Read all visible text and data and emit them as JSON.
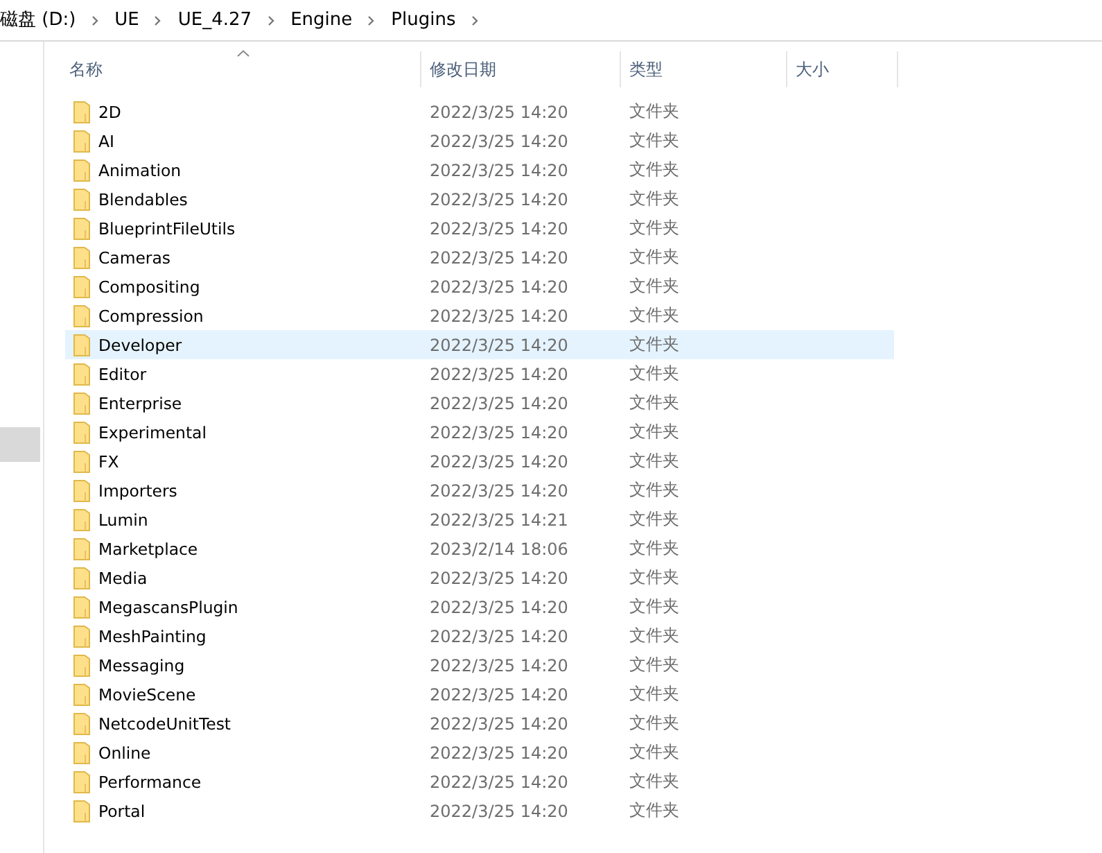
{
  "breadcrumb": [
    "磁盘 (D:)",
    "UE",
    "UE_4.27",
    "Engine",
    "Plugins"
  ],
  "columns": [
    {
      "label": "名称",
      "sorted": true
    },
    {
      "label": "修改日期",
      "sorted": false
    },
    {
      "label": "类型",
      "sorted": false
    },
    {
      "label": "大小",
      "sorted": false
    }
  ],
  "rows": [
    {
      "name": "2D",
      "modified": "2022/3/25 14:20",
      "type": "文件夹",
      "selected": false
    },
    {
      "name": "AI",
      "modified": "2022/3/25 14:20",
      "type": "文件夹",
      "selected": false
    },
    {
      "name": "Animation",
      "modified": "2022/3/25 14:20",
      "type": "文件夹",
      "selected": false
    },
    {
      "name": "Blendables",
      "modified": "2022/3/25 14:20",
      "type": "文件夹",
      "selected": false
    },
    {
      "name": "BlueprintFileUtils",
      "modified": "2022/3/25 14:20",
      "type": "文件夹",
      "selected": false
    },
    {
      "name": "Cameras",
      "modified": "2022/3/25 14:20",
      "type": "文件夹",
      "selected": false
    },
    {
      "name": "Compositing",
      "modified": "2022/3/25 14:20",
      "type": "文件夹",
      "selected": false
    },
    {
      "name": "Compression",
      "modified": "2022/3/25 14:20",
      "type": "文件夹",
      "selected": false
    },
    {
      "name": "Developer",
      "modified": "2022/3/25 14:20",
      "type": "文件夹",
      "selected": true
    },
    {
      "name": "Editor",
      "modified": "2022/3/25 14:20",
      "type": "文件夹",
      "selected": false
    },
    {
      "name": "Enterprise",
      "modified": "2022/3/25 14:20",
      "type": "文件夹",
      "selected": false
    },
    {
      "name": "Experimental",
      "modified": "2022/3/25 14:20",
      "type": "文件夹",
      "selected": false
    },
    {
      "name": "FX",
      "modified": "2022/3/25 14:20",
      "type": "文件夹",
      "selected": false
    },
    {
      "name": "Importers",
      "modified": "2022/3/25 14:20",
      "type": "文件夹",
      "selected": false
    },
    {
      "name": "Lumin",
      "modified": "2022/3/25 14:21",
      "type": "文件夹",
      "selected": false
    },
    {
      "name": "Marketplace",
      "modified": "2023/2/14 18:06",
      "type": "文件夹",
      "selected": false
    },
    {
      "name": "Media",
      "modified": "2022/3/25 14:20",
      "type": "文件夹",
      "selected": false
    },
    {
      "name": "MegascansPlugin",
      "modified": "2022/3/25 14:20",
      "type": "文件夹",
      "selected": false
    },
    {
      "name": "MeshPainting",
      "modified": "2022/3/25 14:20",
      "type": "文件夹",
      "selected": false
    },
    {
      "name": "Messaging",
      "modified": "2022/3/25 14:20",
      "type": "文件夹",
      "selected": false
    },
    {
      "name": "MovieScene",
      "modified": "2022/3/25 14:20",
      "type": "文件夹",
      "selected": false
    },
    {
      "name": "NetcodeUnitTest",
      "modified": "2022/3/25 14:20",
      "type": "文件夹",
      "selected": false
    },
    {
      "name": "Online",
      "modified": "2022/3/25 14:20",
      "type": "文件夹",
      "selected": false
    },
    {
      "name": "Performance",
      "modified": "2022/3/25 14:20",
      "type": "文件夹",
      "selected": false
    },
    {
      "name": "Portal",
      "modified": "2022/3/25 14:20",
      "type": "文件夹",
      "selected": false
    }
  ]
}
